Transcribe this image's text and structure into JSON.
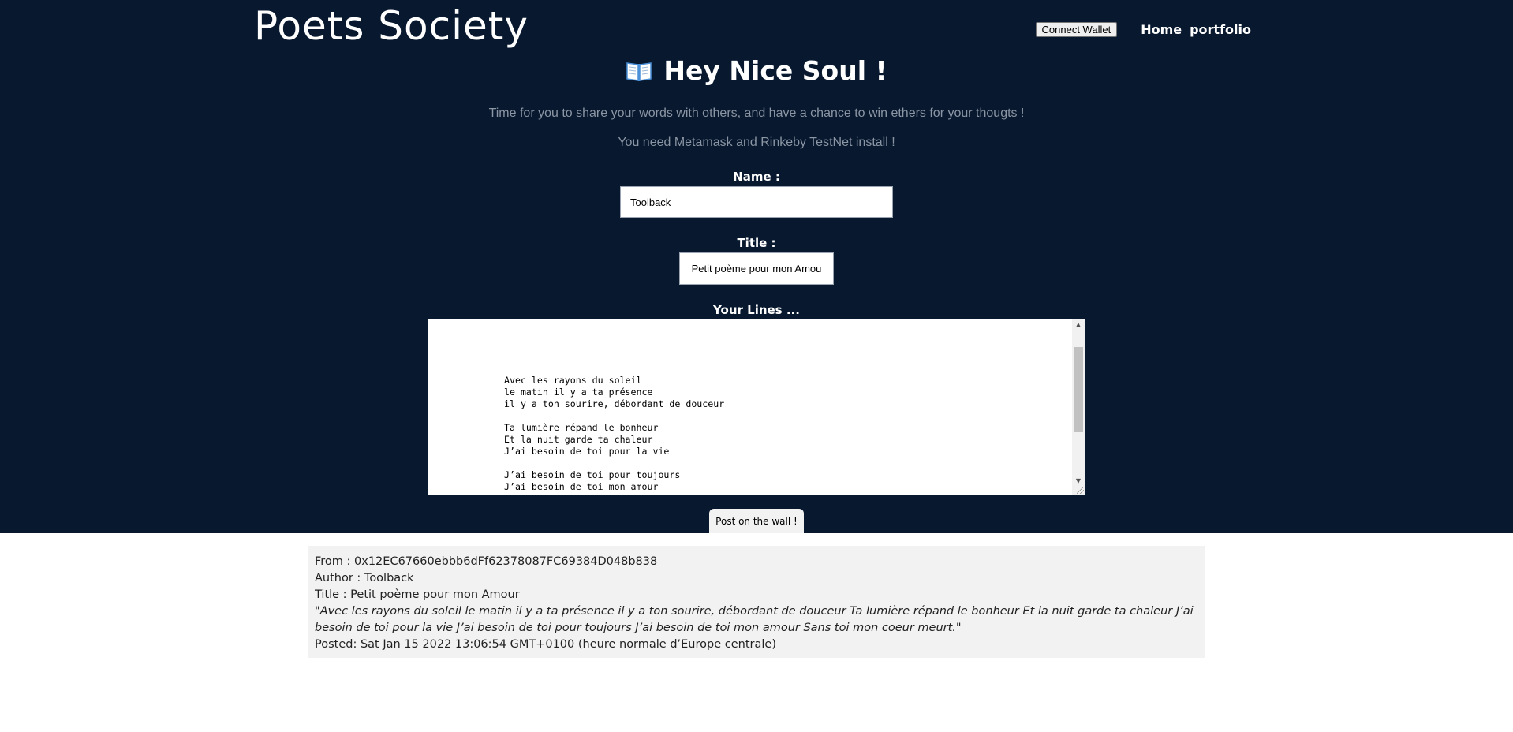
{
  "header": {
    "site_title": "Poets Society",
    "connect_wallet_label": "Connect Wallet",
    "nav": [
      {
        "label": "Home"
      },
      {
        "label": "portfolio"
      }
    ]
  },
  "intro": {
    "heading": "Hey Nice Soul !",
    "icon": "open-book-icon",
    "subtitle": "Time for you to share your words with others, and have a chance to win ethers for your thougts !",
    "requirement": "You need Metamask and Rinkeby TestNet install !"
  },
  "form": {
    "name_label": "Name :",
    "name_value": "Toolback",
    "title_label": "Title :",
    "title_value": "Petit poème pour mon Amou",
    "lines_label": "Your Lines ...",
    "lines_value": "\nAvec les rayons du soleil\nle matin il y a ta présence\nil y a ton sourire, débordant de douceur\n\nTa lumière répand le bonheur\nEt la nuit garde ta chaleur\nJ’ai besoin de toi pour la vie\n\nJ’ai besoin de toi pour toujours\nJ’ai besoin de toi mon amour\nSans toi mon coeur meurt.",
    "submit_label": "Post on the wall !"
  },
  "posts": [
    {
      "from": "From : 0x12EC67660ebbb6dFf62378087FC69384D048b838",
      "author": "Author : Toolback",
      "title": "Title : Petit poème pour mon Amour",
      "text": "\"Avec les rayons du soleil le matin il y a ta présence il y a ton sourire, débordant de douceur Ta lumière répand le bonheur Et la nuit garde ta chaleur J’ai besoin de toi pour la vie J’ai besoin de toi pour toujours J’ai besoin de toi mon amour Sans toi mon coeur meurt.\"",
      "posted": "Posted: Sat Jan 15 2022 13:06:54 GMT+0100 (heure normale d’Europe centrale)"
    }
  ],
  "colors": {
    "hero_background": "#07182f",
    "card_background": "#f2f2f2",
    "subtitle_text": "#8b95a3"
  }
}
